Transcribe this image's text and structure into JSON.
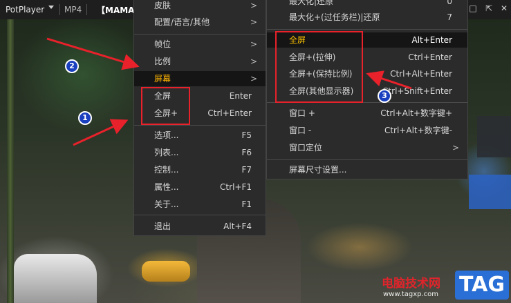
{
  "titlebar": {
    "app_name": "PotPlayer",
    "format": "MP4",
    "file_title": "【MAMA"
  },
  "main_menu": {
    "items": [
      {
        "label": "皮肤",
        "key": "",
        "arrow": ">"
      },
      {
        "label": "配置/语言/其他",
        "key": "",
        "arrow": ">"
      },
      {
        "label": "帧位",
        "key": "",
        "arrow": ">"
      },
      {
        "label": "比例",
        "key": "",
        "arrow": ">"
      },
      {
        "label": "屏幕",
        "key": "",
        "arrow": ">",
        "highlighted": true
      },
      {
        "label": "全屏",
        "key": "Enter"
      },
      {
        "label": "全屏+",
        "key": "Ctrl+Enter"
      },
      {
        "label": "选项...",
        "key": "F5"
      },
      {
        "label": "列表...",
        "key": "F6"
      },
      {
        "label": "控制...",
        "key": "F7"
      },
      {
        "label": "属性...",
        "key": "Ctrl+F1"
      },
      {
        "label": "关于...",
        "key": "F1"
      },
      {
        "label": "退出",
        "key": "Alt+F4"
      }
    ]
  },
  "screen_menu": {
    "items": [
      {
        "label": "最大化|还原",
        "key": "0"
      },
      {
        "label": "最大化+(过任务栏)|还原",
        "key": "7"
      },
      {
        "label": "全屏",
        "key": "Alt+Enter",
        "highlighted": true
      },
      {
        "label": "全屏+(拉伸)",
        "key": "Ctrl+Enter"
      },
      {
        "label": "全屏+(保持比例)",
        "key": "Ctrl+Alt+Enter"
      },
      {
        "label": "全屏(其他显示器)",
        "key": "Ctrl+Shift+Enter"
      },
      {
        "label": "窗口 +",
        "key": "Ctrl+Alt+数字键+"
      },
      {
        "label": "窗口 -",
        "key": "Ctrl+Alt+数字键-"
      },
      {
        "label": "窗口定位",
        "key": "",
        "arrow": ">"
      },
      {
        "label": "屏幕尺寸设置..."
      }
    ]
  },
  "badges": [
    "1",
    "2",
    "3"
  ],
  "watermark": {
    "text": "电脑技术网",
    "url": "www.tagxp.com",
    "tag": "TAG"
  },
  "colors": {
    "highlight_text": "#ffb400",
    "annotation_red": "#e8212b",
    "badge_blue": "#1a3fbf",
    "tag_blue": "#2a6fd6"
  }
}
